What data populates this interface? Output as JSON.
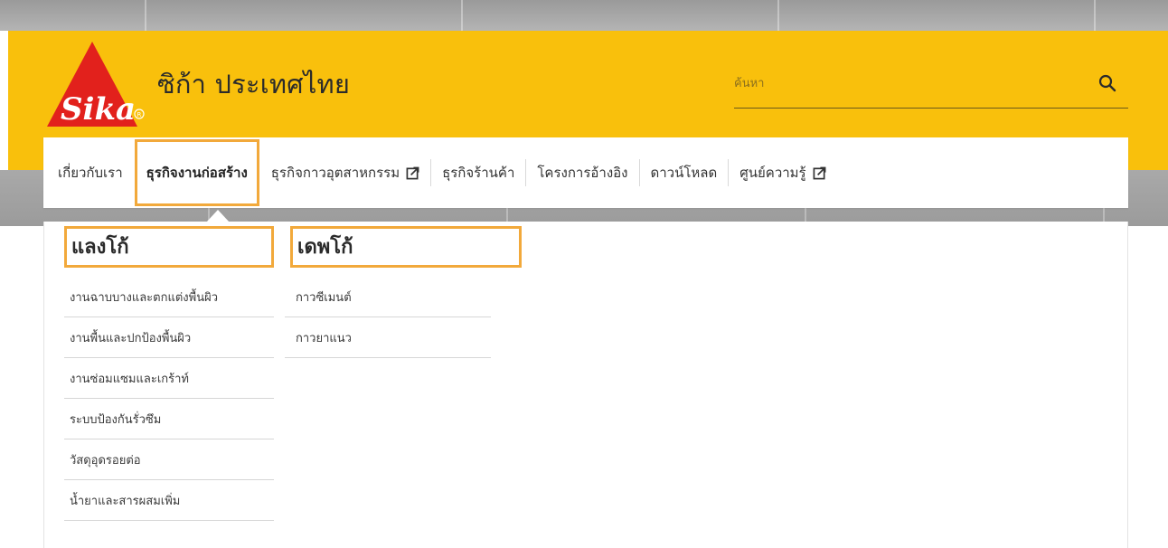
{
  "brand": {
    "logo_text": "Sika",
    "site_title": "ซิก้า ประเทศไทย"
  },
  "search": {
    "placeholder": "ค้นหา",
    "icon": "search-icon"
  },
  "nav": {
    "items": [
      {
        "label": "เกี่ยวกับเรา",
        "external": false
      },
      {
        "label": "ธุรกิจงานก่อสร้าง",
        "external": false,
        "active": true
      },
      {
        "label": "ธุรกิจกาวอุตสาหกรรม",
        "external": true
      },
      {
        "label": "ธุรกิจร้านค้า",
        "external": false
      },
      {
        "label": "โครงการอ้างอิง",
        "external": false
      },
      {
        "label": "ดาวน์โหลด",
        "external": false
      },
      {
        "label": "ศูนย์ความรู้",
        "external": true
      }
    ]
  },
  "dropdown": {
    "columns": [
      {
        "heading": "แลงโก้",
        "items": [
          "งานฉาบบางและตกแต่งพื้นผิว",
          "งานพื้นและปกป้องพื้นผิว",
          "งานซ่อมแซมและเกร้าท์",
          "ระบบป้องกันรั่วซึม",
          "วัสดุอุดรอยต่อ",
          "น้ำยาและสารผสมเพิ่ม"
        ]
      },
      {
        "heading": "เดพโก้",
        "items": [
          "กาวซีเมนต์",
          "กาวยาแนว"
        ]
      }
    ]
  },
  "colors": {
    "brand_yellow": "#f9c00c",
    "highlight_orange": "#f2a93b",
    "sika_red": "#e2211c"
  }
}
